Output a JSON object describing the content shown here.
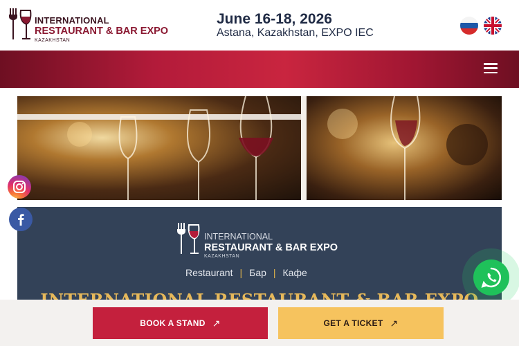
{
  "header": {
    "logo": {
      "line1": "INTERNATIONAL",
      "line2": "RESTAURANT & BAR EXPO",
      "line3": "KAZAKHSTAN"
    },
    "event_date": "June 16-18, 2026",
    "event_place": "Astana, Kazakhstan, EXPO IEC",
    "languages": [
      {
        "code": "ru",
        "icon": "russia-flag-icon"
      },
      {
        "code": "en",
        "icon": "uk-flag-icon"
      }
    ]
  },
  "nav": {
    "menu_icon": "hamburger-menu-icon",
    "gradient": [
      "#6e0f22",
      "#c9253f",
      "#6e0f22"
    ]
  },
  "info": {
    "logo": {
      "line1": "INTERNATIONAL",
      "line2": "RESTAURANT & BAR EXPO",
      "line3": "KAZAKHSTAN"
    },
    "categories": [
      "Restaurant",
      "Бар",
      "Кафе"
    ],
    "category_separator": "|",
    "title": "INTERNATIONAL RESTAURANT & BAR EXPO",
    "background": "#334258",
    "title_color": "#e6b85a"
  },
  "social": [
    {
      "name": "instagram",
      "icon": "instagram-icon"
    },
    {
      "name": "facebook",
      "icon": "facebook-icon"
    }
  ],
  "whatsapp": {
    "icon": "whatsapp-icon",
    "color": "#1fc15a"
  },
  "actions": {
    "book_stand": "BOOK A STAND",
    "get_ticket": "GET A TICKET",
    "arrow": "↗"
  },
  "colors": {
    "brand_red": "#c4203d",
    "brand_yellow": "#f6c35e",
    "navy": "#1f2a44"
  }
}
